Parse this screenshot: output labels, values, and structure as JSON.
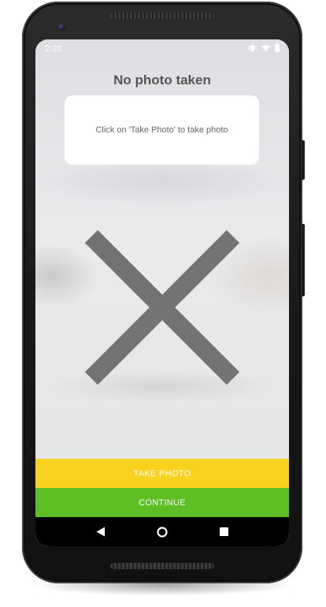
{
  "status_bar": {
    "time": "2:28",
    "icons": [
      "vibrate-icon",
      "wifi-icon",
      "battery-icon"
    ]
  },
  "screen": {
    "title": "No photo taken",
    "hint": "Click on 'Take Photo' to take photo",
    "placeholder_icon": "close-x-icon"
  },
  "actions": {
    "take_photo_label": "TAKE PHOTO",
    "continue_label": "CONTINUE"
  },
  "nav": {
    "back": "back-icon",
    "home": "home-icon",
    "recents": "recents-icon"
  },
  "colors": {
    "take_photo": "#f9d21f",
    "continue": "#5ebf24",
    "icon_gray": "#737373",
    "title_gray": "#555555"
  }
}
